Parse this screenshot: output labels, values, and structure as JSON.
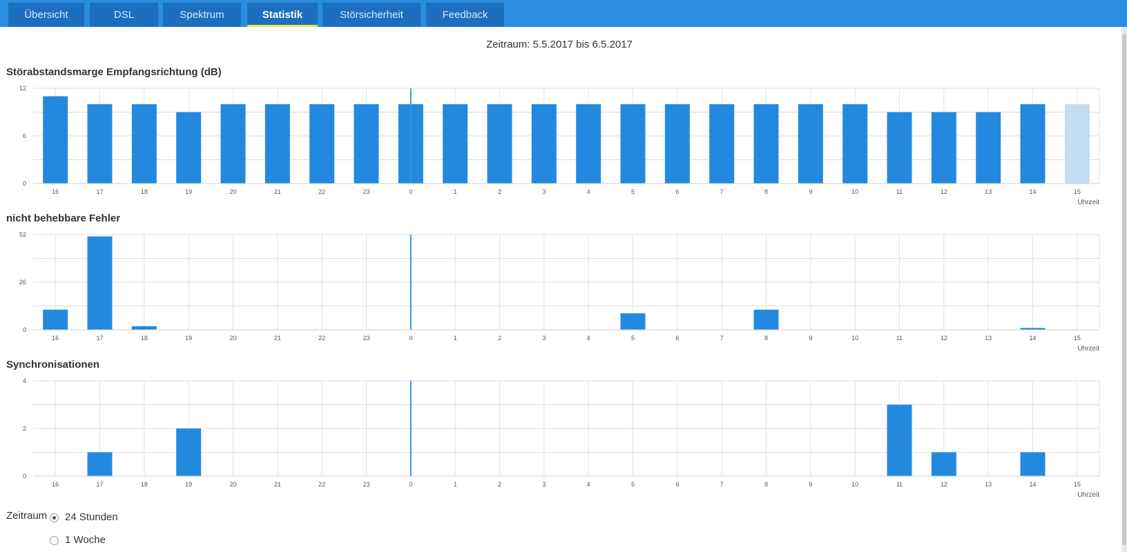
{
  "tabs": [
    {
      "label": "Übersicht",
      "active": false
    },
    {
      "label": "DSL",
      "active": false
    },
    {
      "label": "Spektrum",
      "active": false
    },
    {
      "label": "Statistik",
      "active": true
    },
    {
      "label": "Störsicherheit",
      "active": false
    },
    {
      "label": "Feedback",
      "active": false
    }
  ],
  "period_text": "Zeitraum: 5.5.2017 bis 6.5.2017",
  "colors": {
    "accent": "#2a8de0",
    "tab_bg": "#1c6fbf",
    "bar": "#2389df",
    "bar_pending": "#c2ddf3",
    "active_underline": "#f2e43a"
  },
  "chart_data": [
    {
      "type": "bar",
      "title": "Störabstandsmarge Empfangsrichtung (dB)",
      "categories": [
        "16",
        "17",
        "18",
        "19",
        "20",
        "21",
        "22",
        "23",
        "0",
        "1",
        "2",
        "3",
        "4",
        "5",
        "6",
        "7",
        "8",
        "9",
        "10",
        "11",
        "12",
        "13",
        "14",
        "15"
      ],
      "values": [
        11,
        10,
        10,
        9,
        10,
        10,
        10,
        10,
        10,
        10,
        10,
        10,
        10,
        10,
        10,
        10,
        10,
        10,
        10,
        9,
        9,
        9,
        10,
        10
      ],
      "pending_index": 23,
      "ylim": [
        0,
        12
      ],
      "yticks": [
        "0",
        "6",
        "12"
      ],
      "xlabel": "Uhrzeit",
      "ylabel": "",
      "grid": true,
      "day_divider_category": "0"
    },
    {
      "type": "bar",
      "title": "nicht behebbare Fehler",
      "categories": [
        "16",
        "17",
        "18",
        "19",
        "20",
        "21",
        "22",
        "23",
        "0",
        "1",
        "2",
        "3",
        "4",
        "5",
        "6",
        "7",
        "8",
        "9",
        "10",
        "11",
        "12",
        "13",
        "14",
        "15"
      ],
      "values": [
        11,
        51,
        2,
        0,
        0,
        0,
        0,
        0,
        0,
        0,
        0,
        0,
        0,
        9,
        0,
        0,
        11,
        0,
        0,
        0,
        0,
        0,
        1,
        0
      ],
      "ylim": [
        0,
        52
      ],
      "yticks": [
        "0",
        "26",
        "52"
      ],
      "xlabel": "Uhrzeit",
      "ylabel": "",
      "grid": true,
      "day_divider_category": "0"
    },
    {
      "type": "bar",
      "title": "Synchronisationen",
      "categories": [
        "16",
        "17",
        "18",
        "19",
        "20",
        "21",
        "22",
        "23",
        "0",
        "1",
        "2",
        "3",
        "4",
        "5",
        "6",
        "7",
        "8",
        "9",
        "10",
        "11",
        "12",
        "13",
        "14",
        "15"
      ],
      "values": [
        0,
        1,
        0,
        2,
        0,
        0,
        0,
        0,
        0,
        0,
        0,
        0,
        0,
        0,
        0,
        0,
        0,
        0,
        0,
        3,
        1,
        0,
        1,
        0
      ],
      "ylim": [
        0,
        4
      ],
      "yticks": [
        "0",
        "2",
        "4"
      ],
      "xlabel": "Uhrzeit",
      "ylabel": "",
      "grid": true,
      "day_divider_category": "0"
    }
  ],
  "range_selector": {
    "label": "Zeitraum",
    "options": [
      {
        "label": "24 Stunden",
        "checked": true
      },
      {
        "label": "1 Woche",
        "checked": false
      }
    ]
  }
}
